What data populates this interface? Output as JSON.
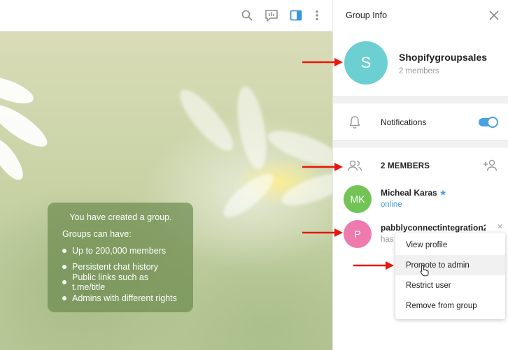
{
  "chat_info": {
    "title": "You have created a group.",
    "subtitle": "Groups can have:",
    "items": [
      "Up to 200,000 members",
      "Persistent chat history",
      "Public links such as t.me/title",
      "Admins with different rights"
    ]
  },
  "panel": {
    "title": "Group Info",
    "group": {
      "avatar_letter": "S",
      "avatar_color": "#6ccfd1",
      "name": "Shopifygroupsales",
      "members_count": "2 members"
    },
    "notifications": {
      "label": "Notifications",
      "enabled": true
    },
    "members_title": "2 MEMBERS",
    "members": [
      {
        "initials": "MK",
        "color": "#73c456",
        "name": "Micheal Karas",
        "status": "online",
        "status_color": "#4aa2e0"
      },
      {
        "initials": "P",
        "color": "#ee7aae",
        "name": "pabblyconnectintegration2",
        "status": "has",
        "status_color": "#999999"
      }
    ]
  },
  "context_menu": {
    "items": [
      "View profile",
      "Promote to admin",
      "Restrict user",
      "Remove from group"
    ]
  },
  "colors": {
    "accent": "#4aa2e0",
    "annotation_arrow": "#e8160c"
  }
}
